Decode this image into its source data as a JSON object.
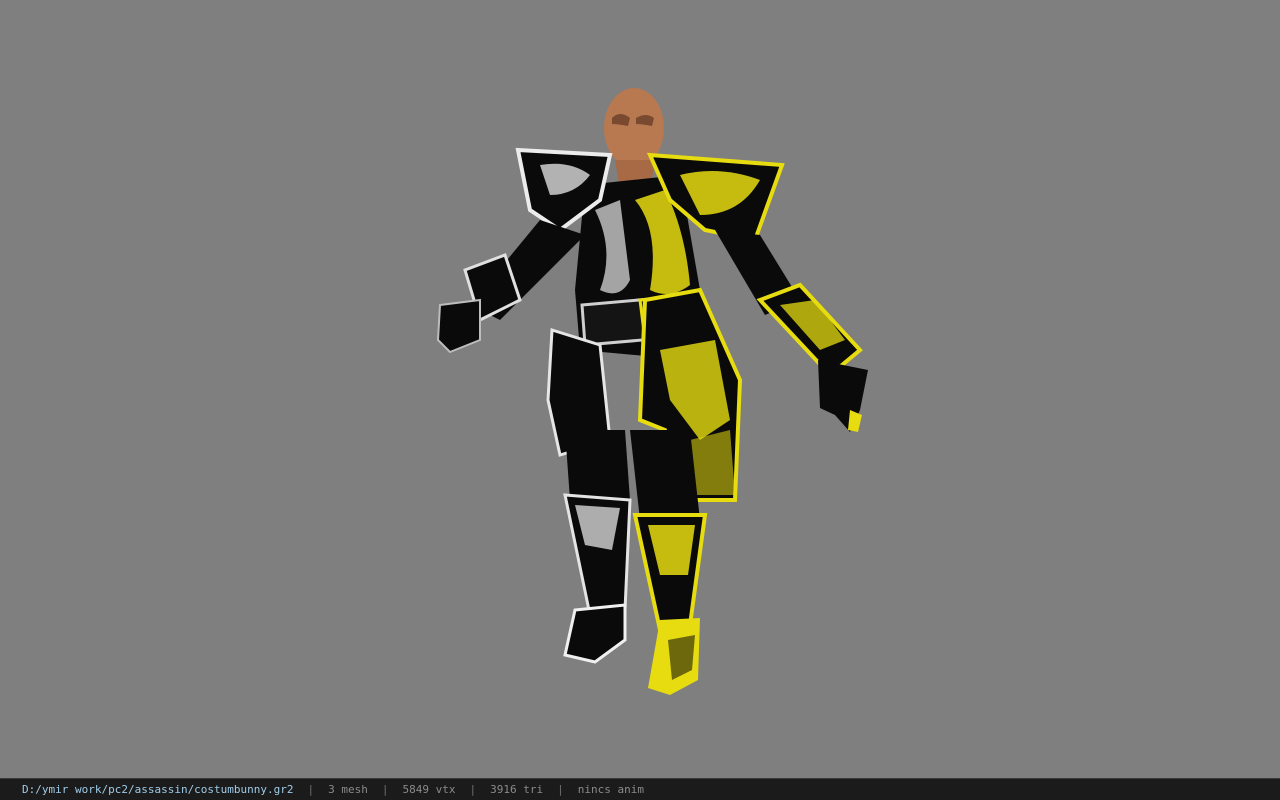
{
  "viewer": {
    "background_color": "#7f7f7f",
    "model": {
      "skin_color": "#b87850",
      "armor_color": "#0a0a0a",
      "trim_left_color": "#e8e8e8",
      "trim_right_color": "#e6dc10"
    }
  },
  "statusbar": {
    "file_path": "D:/ymir work/pc2/assassin/costumbunny.gr2",
    "separator": "|",
    "mesh": "3 mesh",
    "vertices": "5849 vtx",
    "triangles": "3916 tri",
    "animation": "nincs anim"
  }
}
